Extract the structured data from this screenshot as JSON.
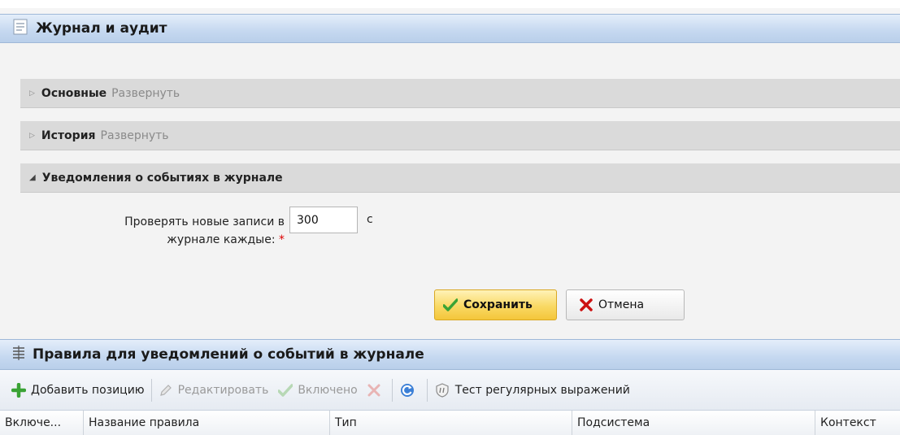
{
  "journal_panel": {
    "title": "Журнал и аудит",
    "sections": [
      {
        "title": "Основные",
        "expand_label": "Развернуть"
      },
      {
        "title": "История",
        "expand_label": "Развернуть"
      },
      {
        "title": "Уведомления о событиях в журнале"
      }
    ],
    "form": {
      "label_line1": "Проверять новые записи в",
      "label_line2": "журнале каждые:",
      "required_mark": "*",
      "value": "300",
      "unit": "с"
    },
    "save_label": "Сохранить",
    "cancel_label": "Отмена"
  },
  "rules_panel": {
    "title": "Правила для уведомлений о событий в журнале",
    "toolbar": {
      "add_label": "Добавить позицию",
      "edit_label": "Редактировать",
      "enable_label": "Включено",
      "regex_label": "Тест регулярных выражений"
    },
    "columns": [
      "Включе...",
      "Название правила",
      "Тип",
      "Подсистема",
      "Контекст"
    ]
  },
  "colors": {
    "accent_header": "#c5d8f0",
    "save_button": "#f9d964",
    "add_icon": "#3aa335",
    "cancel_icon": "#cc1111"
  }
}
